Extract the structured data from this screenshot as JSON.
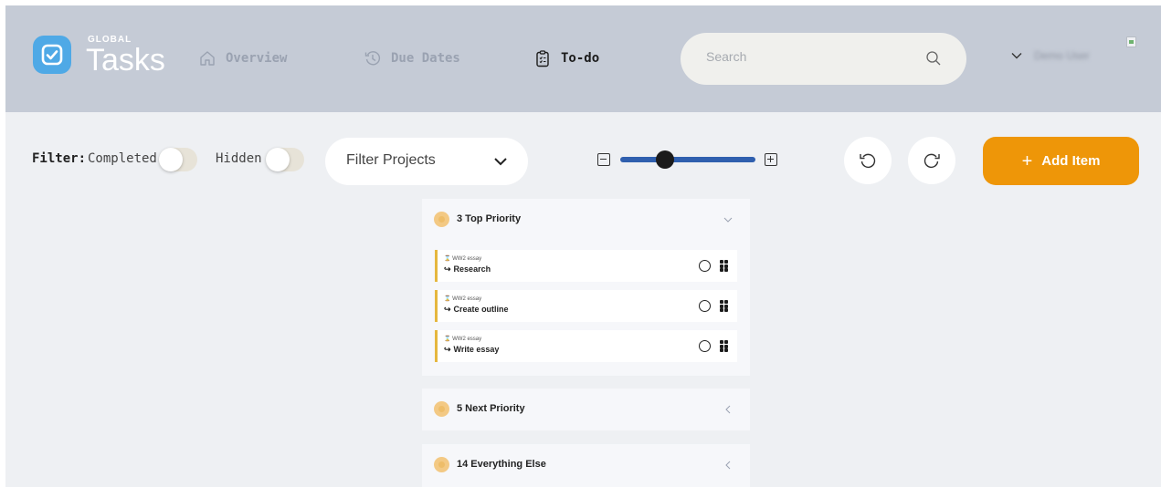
{
  "app": {
    "logo_small": "GLOBAL",
    "logo_big": "Tasks"
  },
  "nav": [
    {
      "label": "Overview",
      "icon": "home-icon",
      "active": false
    },
    {
      "label": "Due Dates",
      "icon": "history-icon",
      "active": false
    },
    {
      "label": "To-do",
      "icon": "clipboard-list-icon",
      "active": true
    }
  ],
  "search": {
    "placeholder": "Search"
  },
  "user": {
    "name": "Demo User"
  },
  "toolbar": {
    "filter_label": "Filter:",
    "completed_label": "Completed",
    "completed_on": false,
    "hidden_label": "Hidden",
    "hidden_on": false,
    "filter_projects": "Filter Projects",
    "zoom_level": 0.33,
    "add_item": "Add Item"
  },
  "panels": [
    {
      "title": "3 Top Priority",
      "expanded": true,
      "tasks": [
        {
          "project": "WW2 essay",
          "name": "Research"
        },
        {
          "project": "WW2 essay",
          "name": "Create outline"
        },
        {
          "project": "WW2 essay",
          "name": "Write essay"
        }
      ]
    },
    {
      "title": "5 Next Priority",
      "expanded": false
    },
    {
      "title": "14 Everything Else",
      "expanded": false
    }
  ],
  "colors": {
    "header_bg": "#c5cbd6",
    "accent_blue": "#4fa9e6",
    "slider_blue": "#2f5fae",
    "add_orange": "#ee9608",
    "task_bar": "#e5b73e",
    "priority_dot": "#f3c984"
  }
}
